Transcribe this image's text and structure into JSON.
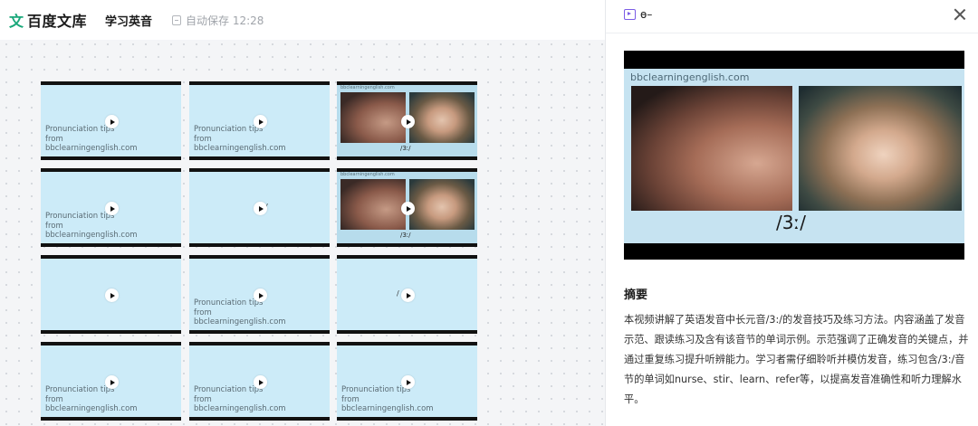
{
  "header": {
    "logo_icon": "文",
    "logo_text": "百度文库",
    "doc_title": "学习英音",
    "save_status": "自动保存 12:28"
  },
  "cards": [
    {
      "type": "text",
      "line1": "Pronunciation tips",
      "line2": "from",
      "line3": "bbclearningenglish.com"
    },
    {
      "type": "text",
      "line1": "Pronunciation tips",
      "line2": "from",
      "line3": "bbclearningenglish.com"
    },
    {
      "type": "faces",
      "url": "bbclearningenglish.com",
      "symbol": "/3ː/"
    },
    {
      "type": "text",
      "line1": "Pronunciation tips",
      "line2": "from",
      "line3": "bbclearningenglish.com"
    },
    {
      "type": "symbol",
      "symbol": "/"
    },
    {
      "type": "faces",
      "url": "bbclearningenglish.com",
      "symbol": "/3ː/"
    },
    {
      "type": "blank"
    },
    {
      "type": "text",
      "line1": "Pronunciation tips",
      "line2": "from",
      "line3": "bbclearningenglish.com"
    },
    {
      "type": "symbol",
      "symbol": "/ ː/"
    },
    {
      "type": "text",
      "line1": "Pronunciation tips",
      "line2": "from",
      "line3": "bbclearningenglish.com"
    },
    {
      "type": "text",
      "line1": "Pronunciation tips",
      "line2": "from",
      "line3": "bbclearningenglish.com"
    },
    {
      "type": "text",
      "line1": "Pronunciation tips",
      "line2": "from",
      "line3": "bbclearningenglish.com"
    }
  ],
  "panel": {
    "title": "ɵ–",
    "video_url": "bbclearningenglish.com",
    "video_symbol": "/3ː/",
    "summary_title": "摘要",
    "summary_text": "本视频讲解了英语发音中长元音/3:/的发音技巧及练习方法。内容涵盖了发音示范、跟读练习及含有该音节的单词示例。示范强调了正确发音的关键点，并通过重复练习提升听辨能力。学习者需仔细聆听并模仿发音，练习包含/3:/音节的单词如nurse、stir、learn、refer等，以提高发音准确性和听力理解水平。"
  }
}
